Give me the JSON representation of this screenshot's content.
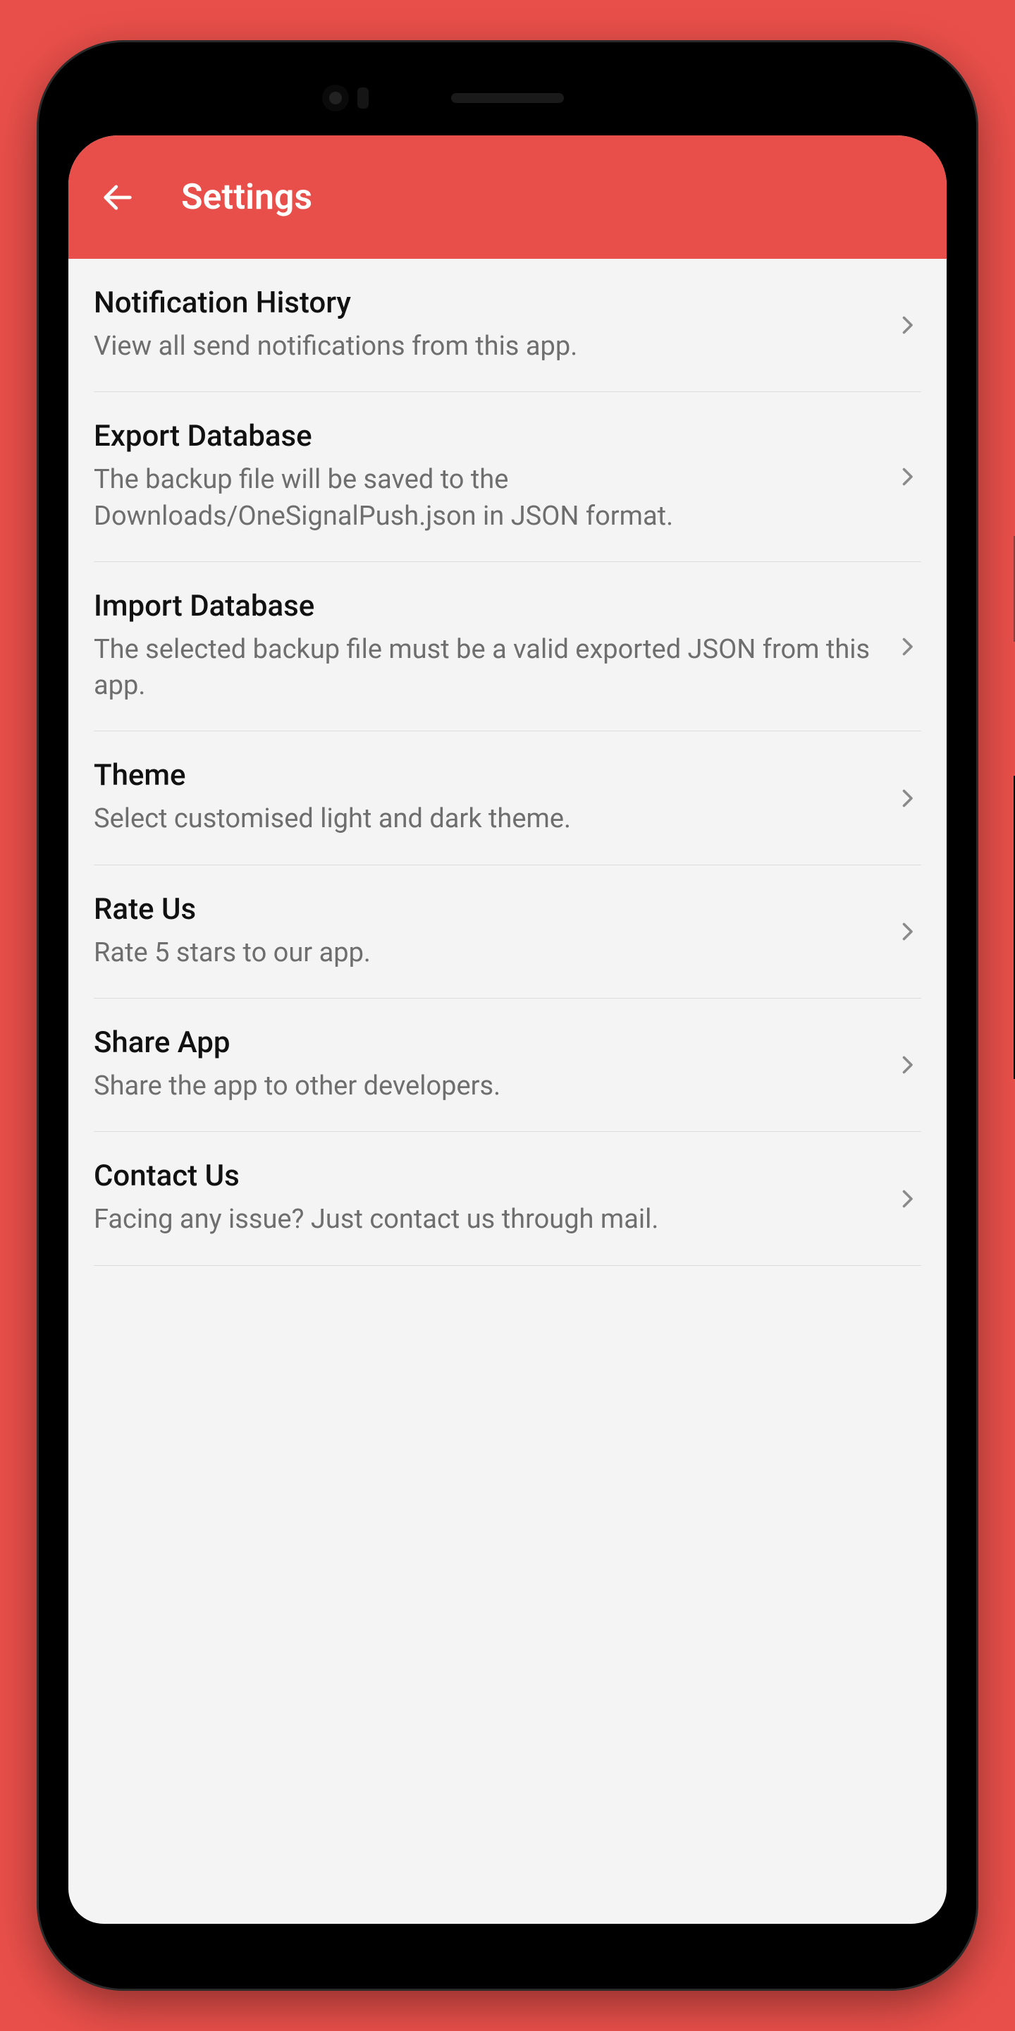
{
  "appbar": {
    "title": "Settings"
  },
  "items": [
    {
      "title": "Notification History",
      "subtitle": "View all send notifications from this app."
    },
    {
      "title": "Export Database",
      "subtitle": "The backup file will be saved to the Downloads/OneSignalPush.json in JSON format."
    },
    {
      "title": "Import Database",
      "subtitle": "The selected backup file must be a valid exported JSON from this app."
    },
    {
      "title": "Theme",
      "subtitle": "Select customised light and dark theme."
    },
    {
      "title": "Rate Us",
      "subtitle": "Rate 5 stars to our app."
    },
    {
      "title": "Share App",
      "subtitle": "Share the app to other developers."
    },
    {
      "title": "Contact Us",
      "subtitle": "Facing any issue? Just contact us through mail."
    }
  ]
}
